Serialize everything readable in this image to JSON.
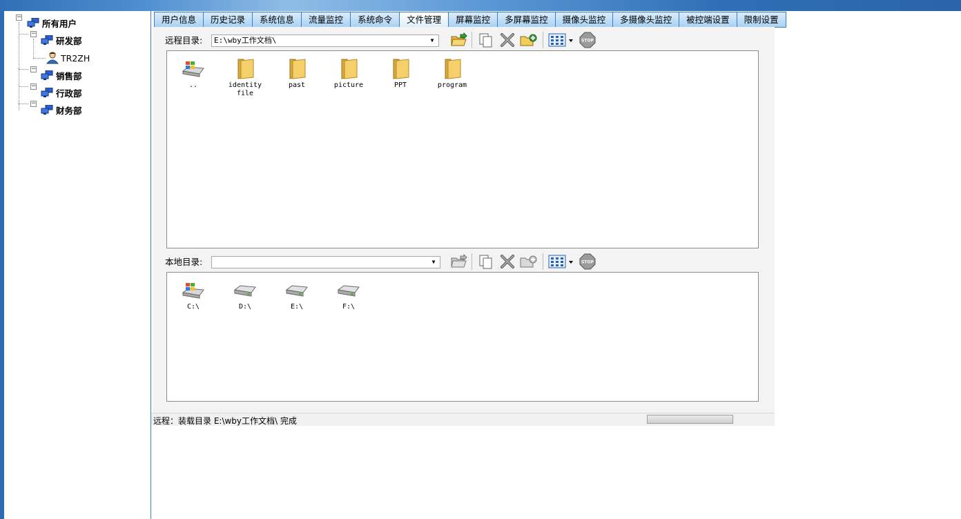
{
  "tree": {
    "root": "所有用户",
    "groups": [
      {
        "label": "研发部",
        "users": [
          "TR2ZH"
        ]
      },
      {
        "label": "销售部",
        "users": []
      },
      {
        "label": "行政部",
        "users": []
      },
      {
        "label": "财务部",
        "users": []
      }
    ],
    "collapse_glyph": "−"
  },
  "tabs": [
    "用户信息",
    "历史记录",
    "系统信息",
    "流量监控",
    "系统命令",
    "文件管理",
    "屏幕监控",
    "多屏幕监控",
    "摄像头监控",
    "多摄像头监控",
    "被控端设置",
    "限制设置"
  ],
  "active_tab": "文件管理",
  "remote": {
    "label": "远程目录:",
    "path": "E:\\wby工作文档\\",
    "items": [
      {
        "name": "..",
        "icon": "drive-windows-icon"
      },
      {
        "name": "identity file",
        "icon": "folder-icon"
      },
      {
        "name": "past",
        "icon": "folder-icon"
      },
      {
        "name": "picture",
        "icon": "folder-icon"
      },
      {
        "name": "PPT",
        "icon": "folder-icon"
      },
      {
        "name": "program",
        "icon": "folder-icon"
      }
    ]
  },
  "local": {
    "label": "本地目录:",
    "path": "",
    "items": [
      {
        "name": "C:\\",
        "icon": "drive-windows-icon"
      },
      {
        "name": "D:\\",
        "icon": "drive-icon"
      },
      {
        "name": "E:\\",
        "icon": "drive-icon"
      },
      {
        "name": "F:\\",
        "icon": "drive-icon"
      }
    ]
  },
  "toolbar_icons": [
    "open-folder-icon",
    "copy-icon",
    "delete-icon",
    "new-folder-icon",
    "view-icon",
    "stop-icon"
  ],
  "stop_text": "STOP",
  "status": {
    "text": "远程：装载目录 E:\\wby工作文档\\ 完成"
  },
  "colors": {
    "accent": "#3b7bc2",
    "folder": "#f5cf6a",
    "tab": "#b9dcf6"
  }
}
